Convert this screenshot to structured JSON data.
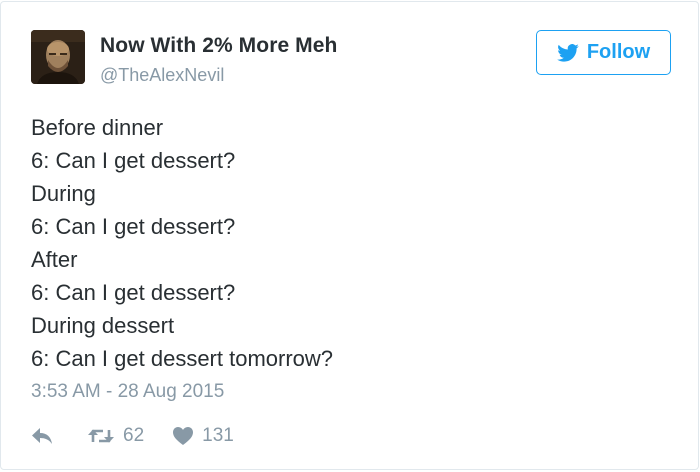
{
  "user": {
    "display_name": "Now With 2% More Meh",
    "handle": "@TheAlexNevil",
    "avatar_icon": "user-avatar"
  },
  "follow_button": {
    "label": "Follow",
    "icon": "twitter-bird-icon",
    "color": "#1da1f2"
  },
  "tweet": {
    "lines": [
      "Before dinner",
      "6: Can I get dessert?",
      "During",
      "6: Can I get dessert?",
      "After",
      "6: Can I get dessert?",
      "During dessert",
      "6: Can I get dessert tomorrow?"
    ],
    "timestamp": "3:53 AM - 28 Aug 2015"
  },
  "actions": {
    "reply_icon": "reply-icon",
    "retweet_icon": "retweet-icon",
    "retweet_count": "62",
    "like_icon": "heart-icon",
    "like_count": "131"
  },
  "colors": {
    "text": "#292f33",
    "muted": "#8899a6",
    "border": "#e1e8ed",
    "accent": "#1da1f2"
  }
}
